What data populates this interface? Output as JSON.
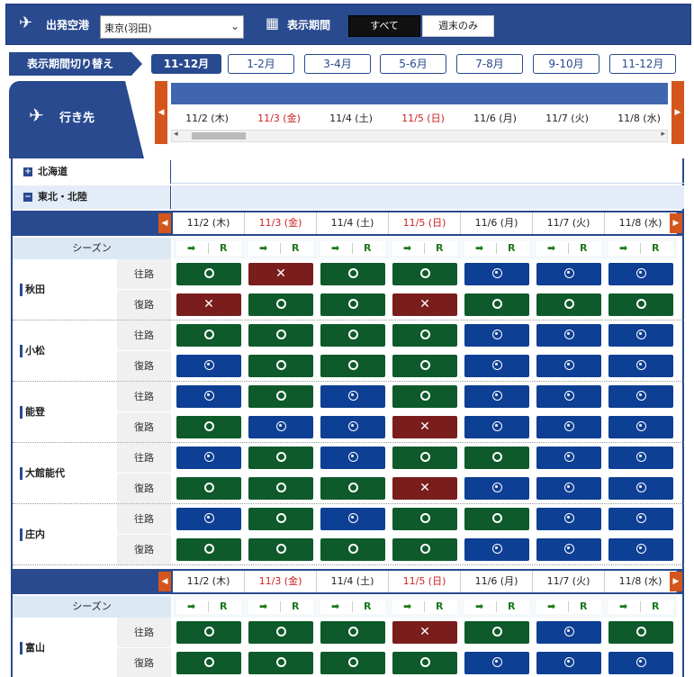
{
  "header": {
    "departure_label": "出発空港",
    "airport_value": "東京(羽田)",
    "display_period_label": "表示期間",
    "seg_all": "すべて",
    "seg_weekend": "週末のみ"
  },
  "period": {
    "label": "表示期間切り替え",
    "buttons": [
      "11-12月",
      "1-2月",
      "3-4月",
      "5-6月",
      "7-8月",
      "9-10月",
      "11-12月"
    ],
    "active_index": 0
  },
  "destinations_tab": {
    "label": "行き先"
  },
  "dates": [
    {
      "label": "11/2 (木)",
      "red": false
    },
    {
      "label": "11/3 (金)",
      "red": true
    },
    {
      "label": "11/4 (土)",
      "red": false
    },
    {
      "label": "11/5 (日)",
      "red": true
    },
    {
      "label": "11/6 (月)",
      "red": false
    },
    {
      "label": "11/7 (火)",
      "red": false
    },
    {
      "label": "11/8 (水)",
      "red": false
    }
  ],
  "season": {
    "label": "シーズン",
    "arrow": "➡",
    "r": "R"
  },
  "legs": {
    "outbound": "往路",
    "return": "復路"
  },
  "regions": [
    {
      "name": "北海道",
      "toggle": "+",
      "open": false
    },
    {
      "name": "東北・北陸",
      "toggle": "−",
      "open": true
    }
  ],
  "routes": [
    {
      "name": "秋田",
      "out": [
        "o",
        "x",
        "o",
        "o",
        "d",
        "d",
        "d"
      ],
      "ret": [
        "x",
        "o",
        "o",
        "x",
        "o",
        "o",
        "o"
      ]
    },
    {
      "name": "小松",
      "out": [
        "o",
        "o",
        "o",
        "o",
        "d",
        "d",
        "d"
      ],
      "ret": [
        "d",
        "o",
        "o",
        "o",
        "d",
        "d",
        "d"
      ]
    },
    {
      "name": "能登",
      "out": [
        "d",
        "o",
        "d",
        "o",
        "d",
        "d",
        "d"
      ],
      "ret": [
        "o",
        "d",
        "d",
        "x",
        "d",
        "d",
        "d"
      ]
    },
    {
      "name": "大館能代",
      "out": [
        "d",
        "o",
        "d",
        "o",
        "o",
        "d",
        "d"
      ],
      "ret": [
        "o",
        "o",
        "o",
        "x",
        "d",
        "d",
        "d"
      ]
    },
    {
      "name": "庄内",
      "out": [
        "d",
        "o",
        "d",
        "o",
        "o",
        "d",
        "d"
      ],
      "ret": [
        "o",
        "o",
        "o",
        "o",
        "d",
        "d",
        "d"
      ]
    },
    {
      "name": "富山",
      "out": [
        "o",
        "o",
        "o",
        "x",
        "o",
        "d",
        "o"
      ],
      "ret": [
        "o",
        "o",
        "o",
        "o",
        "d",
        "d",
        "d"
      ]
    }
  ],
  "status_symbols": {
    "o": "circle",
    "x": "✕",
    "d": "dot-circle"
  },
  "colors": {
    "navy": "#294a8f",
    "ok_green": "#0e5a2a",
    "full_red": "#7a1d1d",
    "avail_blue": "#0d3f94",
    "nav_orange": "#d4561c",
    "holiday_red": "#cc2222"
  }
}
